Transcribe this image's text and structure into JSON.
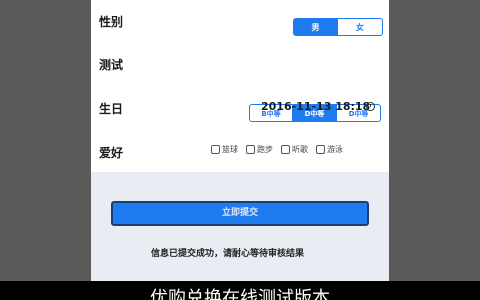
{
  "form": {
    "gender": {
      "label": "性别",
      "options": [
        "男",
        "女"
      ],
      "selected": "男"
    },
    "test": {
      "label": "测试",
      "options": [
        "B中等",
        "D中等",
        "D中等"
      ],
      "selected": "D中等"
    },
    "birthday": {
      "label": "生日",
      "value": "2016-11-13 18:18"
    },
    "hobby": {
      "label": "爱好",
      "options": [
        "篮球",
        "跑步",
        "听歌",
        "游泳"
      ]
    }
  },
  "actions": {
    "submit_label": "立即提交",
    "notice": "信息已提交成功，请耐心等待审核结果"
  },
  "caption": {
    "text": "优购兑换在线测试版本"
  }
}
